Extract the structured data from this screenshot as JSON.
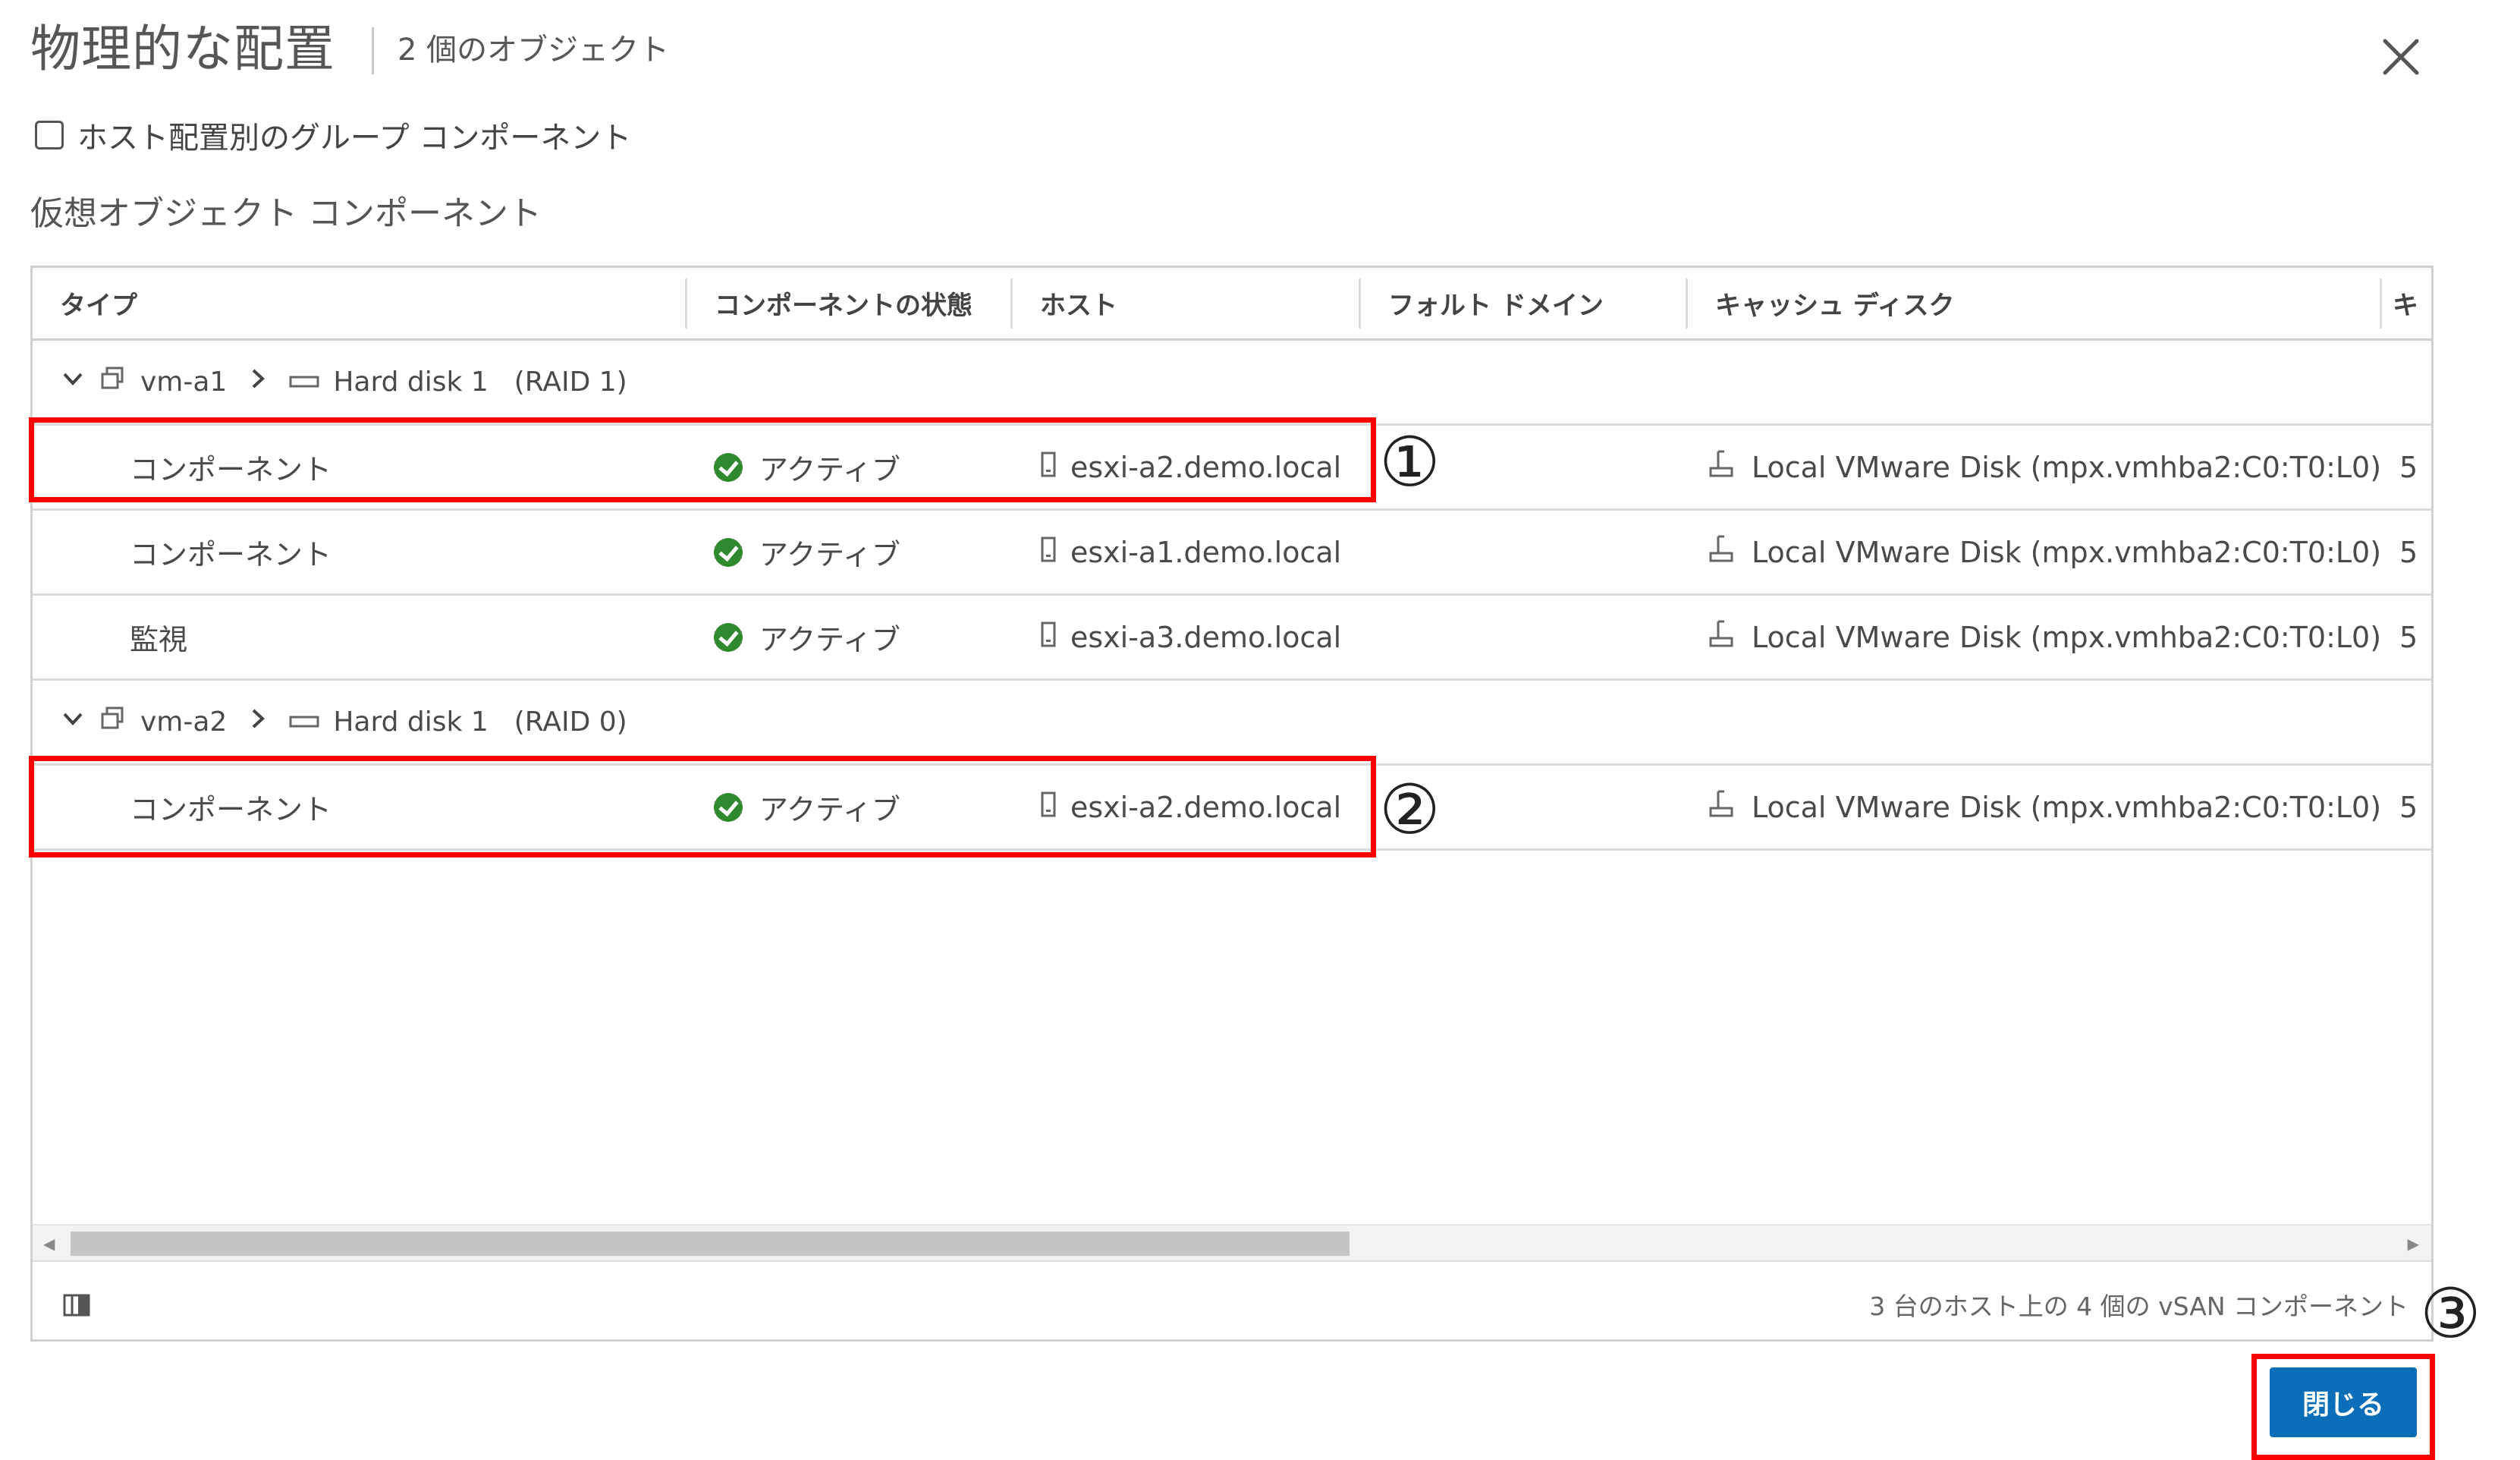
{
  "dialog": {
    "title": "物理的な配置",
    "subtitle": "2 個のオブジェクト",
    "group_by_host_label": "ホスト配置別のグループ コンポーネント",
    "section_label": "仮想オブジェクト コンポーネント",
    "close_button_label": "閉じる"
  },
  "grid": {
    "columns": [
      "タイプ",
      "コンポーネントの状態",
      "ホスト",
      "フォルト ドメイン",
      "キャッシュ ディスク",
      "キ"
    ],
    "groups": [
      {
        "vm": "vm-a1",
        "disk": "Hard disk 1",
        "raid": "(RAID 1)",
        "rows": [
          {
            "type": "コンポーネント",
            "state": "アクティブ",
            "host": "esxi-a2.demo.local",
            "fault_domain": "",
            "cache_disk": "Local VMware Disk (mpx.vmhba2:C0:T0:L0)",
            "extra": "5"
          },
          {
            "type": "コンポーネント",
            "state": "アクティブ",
            "host": "esxi-a1.demo.local",
            "fault_domain": "",
            "cache_disk": "Local VMware Disk (mpx.vmhba2:C0:T0:L0)",
            "extra": "5"
          },
          {
            "type": "監視",
            "state": "アクティブ",
            "host": "esxi-a3.demo.local",
            "fault_domain": "",
            "cache_disk": "Local VMware Disk (mpx.vmhba2:C0:T0:L0)",
            "extra": "5"
          }
        ]
      },
      {
        "vm": "vm-a2",
        "disk": "Hard disk 1",
        "raid": "(RAID 0)",
        "rows": [
          {
            "type": "コンポーネント",
            "state": "アクティブ",
            "host": "esxi-a2.demo.local",
            "fault_domain": "",
            "cache_disk": "Local VMware Disk (mpx.vmhba2:C0:T0:L0)",
            "extra": "5"
          }
        ]
      }
    ],
    "footer_text": "3 台のホスト上の 4 個の vSAN コンポーネント"
  },
  "annotations": {
    "callout_1": "①",
    "callout_2": "②",
    "callout_3": "③",
    "highlight_color": "#ff0000"
  },
  "colors": {
    "primary_button": "#0a6eb8",
    "status_ok": "#2f8a2f"
  },
  "icons": {
    "close": "close-icon",
    "expand": "chevron-down-icon",
    "breadcrumb_sep": "chevron-right-icon",
    "vm": "vm-icon",
    "disk": "disk-icon",
    "status": "check-circle-icon",
    "host": "host-server-icon",
    "cache_disk": "storage-disk-icon",
    "column_toggle": "column-toggle-icon"
  }
}
